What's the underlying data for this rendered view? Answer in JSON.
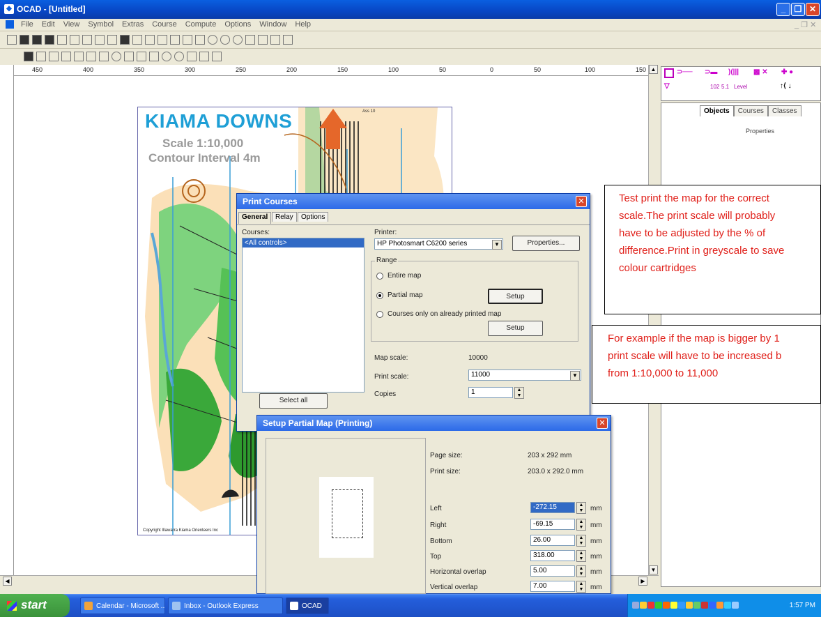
{
  "app": {
    "title": "OCAD - [Untitled]"
  },
  "menu": [
    "File",
    "Edit",
    "View",
    "Symbol",
    "Extras",
    "Course",
    "Compute",
    "Options",
    "Window",
    "Help"
  ],
  "ruler": {
    "labels": [
      "450",
      "400",
      "350",
      "300",
      "250",
      "200",
      "150",
      "100",
      "50",
      "0",
      "50",
      "100",
      "150"
    ]
  },
  "map": {
    "title": "KIAMA DOWNS",
    "scale": "Scale 1:10,000",
    "contour": "Contour Interval 4m",
    "copyright": "Copyright Illawarra Kiama Orienteers Inc",
    "north_label": "Ass 10"
  },
  "panel": {
    "tabs": [
      "Objects",
      "Courses",
      "Classes"
    ],
    "properties": "Properties",
    "palette_labels": [
      "102",
      "5.1",
      "Level"
    ]
  },
  "print_dialog": {
    "title": "Print Courses",
    "tabs": [
      "General",
      "Relay",
      "Options"
    ],
    "courses_label": "Courses:",
    "course_item": "<All controls>",
    "select_all": "Select all",
    "printer_label": "Printer:",
    "printer_value": "HP Photosmart C6200 series",
    "properties_btn": "Properties...",
    "range_label": "Range",
    "range_options": [
      "Entire map",
      "Partial map",
      "Courses only on already printed map"
    ],
    "setup_btn": "Setup",
    "map_scale_label": "Map scale:",
    "map_scale_value": "10000",
    "print_scale_label": "Print scale:",
    "print_scale_value": "11000",
    "copies_label": "Copies",
    "copies_value": "1"
  },
  "setup_dialog": {
    "title": "Setup Partial Map (Printing)",
    "page_size_label": "Page size:",
    "page_size_value": "203 x 292 mm",
    "print_size_label": "Print size:",
    "print_size_value": "203.0 x 292.0 mm",
    "fields": [
      {
        "label": "Left",
        "value": "-272.15",
        "unit": "mm"
      },
      {
        "label": "Right",
        "value": "-69.15",
        "unit": "mm"
      },
      {
        "label": "Bottom",
        "value": "26.00",
        "unit": "mm"
      },
      {
        "label": "Top",
        "value": "318.00",
        "unit": "mm"
      },
      {
        "label": "Horizontal overlap",
        "value": "5.00",
        "unit": "mm"
      },
      {
        "label": "Vertical overlap",
        "value": "7.00",
        "unit": "mm"
      }
    ]
  },
  "notes": [
    {
      "lines": [
        "Test print the map for the correct",
        "scale.The print scale will probably",
        "have to be adjusted by the % of",
        "difference.Print in greyscale to save",
        "colour cartridges"
      ]
    },
    {
      "lines": [
        "For example if the map is bigger by 1",
        "print scale will have to be increased b",
        "from 1:10,000 to 11,000"
      ]
    }
  ],
  "taskbar": {
    "start": "start",
    "tasks": [
      "Calendar - Microsoft ...",
      "Inbox - Outlook Express",
      "OCAD"
    ],
    "clock": "1:57 PM"
  },
  "colors": {
    "accent": "#0a5fe0",
    "note_text": "#e0201a",
    "map_title": "#1e9fd6"
  }
}
